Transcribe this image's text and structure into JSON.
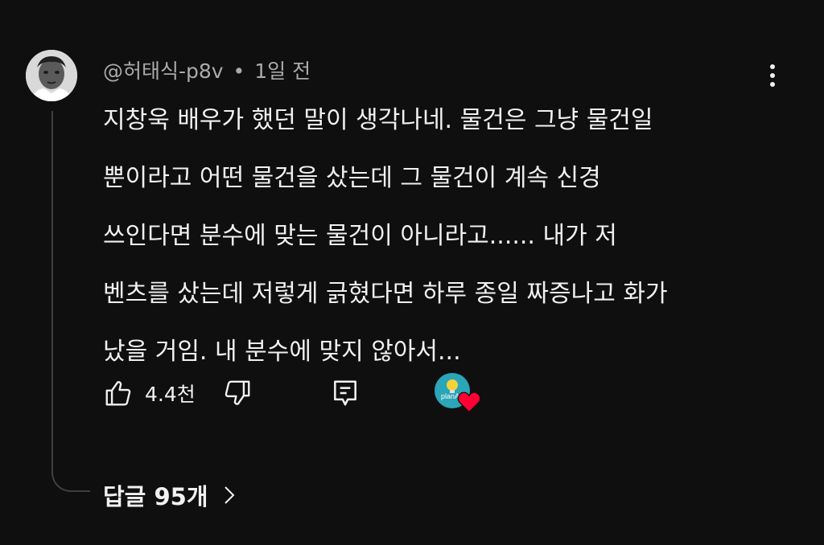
{
  "comment": {
    "author": "@허태식-p8v",
    "separator": "•",
    "timestamp": "1일 전",
    "text_lines": [
      "지창욱 배우가 했던 말이 생각나네. 물건은 그냥 물건일",
      "뿐이라고 어떤 물건을 샀는데 그 물건이 계속 신경",
      "쓰인다면 분수에 맞는 물건이 아니라고...... 내가 저",
      "벤츠를 샀는데 저렇게 긁혔다면 하루 종일 짜증나고 화가",
      "났을 거임. 내 분수에 맞지 않아서..."
    ],
    "like_count": "4.4천"
  },
  "creator_heart": {
    "channel_brand": "planAn",
    "heart_color": "#ff0033",
    "avatar_color": "#2aa6b8"
  },
  "replies": {
    "label": "답글 95개"
  },
  "icons": {
    "like": "thumbs-up-icon",
    "dislike": "thumbs-down-icon",
    "reply": "comment-reply-icon",
    "more": "more-vertical-icon",
    "expand": "chevron-right-icon"
  },
  "colors": {
    "background": "#0f0f0f",
    "text": "#f1f1f1",
    "secondary_text": "#aaaaaa",
    "thread_line": "#3f3f3f"
  }
}
